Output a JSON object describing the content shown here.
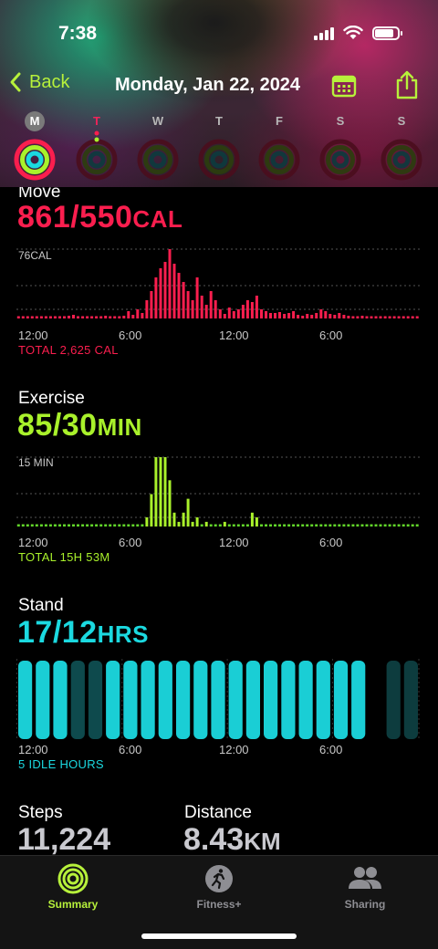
{
  "status_bar": {
    "time": "7:38",
    "battery_level": 0.85
  },
  "nav": {
    "back_label": "Back",
    "title": "Monday, Jan 22, 2024"
  },
  "week": [
    {
      "letter": "M",
      "state": "current"
    },
    {
      "letter": "T",
      "state": "today"
    },
    {
      "letter": "W",
      "state": "normal"
    },
    {
      "letter": "T",
      "state": "normal"
    },
    {
      "letter": "F",
      "state": "normal"
    },
    {
      "letter": "S",
      "state": "normal"
    },
    {
      "letter": "S",
      "state": "normal"
    }
  ],
  "move": {
    "title": "Move",
    "value": "861/550",
    "unit": "CAL",
    "max_label": "76CAL",
    "total": "TOTAL 2,625 CAL",
    "color": "#fa1e4e",
    "dim_color": "#d21a43"
  },
  "exercise": {
    "title": "Exercise",
    "value": "85/30",
    "unit": "MIN",
    "max_label": "15 MIN",
    "total": "TOTAL 15H 53M",
    "color": "#a9f12b",
    "dim_color": "#62d62a"
  },
  "stand": {
    "title": "Stand",
    "value": "17/12",
    "unit": "HRS",
    "total": "5 IDLE HOURS",
    "color": "#1bd9e0"
  },
  "axis_ticks": [
    "12:00",
    "6:00",
    "12:00",
    "6:00"
  ],
  "steps": {
    "label": "Steps",
    "value": "11,224"
  },
  "distance": {
    "label": "Distance",
    "value": "8.43",
    "unit": "KM"
  },
  "tabs": [
    {
      "label": "Summary",
      "active": true,
      "icon": "activity-rings-icon"
    },
    {
      "label": "Fitness+",
      "active": false,
      "icon": "running-figure-icon"
    },
    {
      "label": "Sharing",
      "active": false,
      "icon": "people-icon"
    }
  ],
  "chart_data": [
    {
      "type": "bar",
      "name": "Move",
      "ylabel": "76CAL",
      "x_ticks": [
        "12:00",
        "6:00",
        "12:00",
        "6:00"
      ],
      "values": [
        2,
        2,
        2,
        2,
        2,
        2,
        2,
        2,
        2,
        2,
        2,
        3,
        4,
        2,
        2,
        2,
        2,
        2,
        2,
        3,
        2,
        2,
        2,
        3,
        8,
        4,
        10,
        6,
        20,
        30,
        45,
        55,
        62,
        76,
        60,
        50,
        40,
        30,
        20,
        45,
        25,
        15,
        30,
        20,
        10,
        5,
        12,
        8,
        10,
        15,
        20,
        18,
        25,
        10,
        8,
        6,
        6,
        7,
        5,
        6,
        8,
        4,
        3,
        5,
        4,
        6,
        10,
        8,
        5,
        4,
        6,
        4,
        3,
        2,
        2,
        3,
        2,
        2,
        2,
        2,
        2,
        2,
        2,
        2,
        2,
        2,
        2,
        2
      ],
      "total": "TOTAL 2,625 CAL"
    },
    {
      "type": "bar",
      "name": "Exercise",
      "ylabel": "15 MIN",
      "x_ticks": [
        "12:00",
        "6:00",
        "12:00",
        "6:00"
      ],
      "values": [
        0,
        0,
        0,
        0,
        0,
        0,
        0,
        0,
        0,
        0,
        0,
        0,
        0,
        0,
        0,
        0,
        0,
        0,
        0,
        0,
        0,
        0,
        0,
        0,
        0,
        0,
        0,
        0,
        2,
        7,
        15,
        15,
        15,
        10,
        3,
        1,
        3,
        6,
        1,
        2,
        0,
        1,
        0,
        0,
        0,
        1,
        0,
        0,
        0,
        0,
        0,
        3,
        2,
        0,
        0,
        0,
        0,
        0,
        0,
        0,
        0,
        0,
        0,
        0,
        0,
        0,
        0,
        0,
        0,
        0,
        0,
        0,
        0,
        0,
        0,
        0,
        0,
        0,
        0,
        0,
        0,
        0,
        0,
        0,
        0,
        0,
        0,
        0
      ],
      "total": "TOTAL 15H 53M"
    },
    {
      "type": "bar",
      "name": "Stand",
      "x_ticks": [
        "12:00",
        "6:00",
        "12:00",
        "6:00"
      ],
      "values": [
        1,
        1,
        1,
        0,
        0,
        1,
        1,
        1,
        1,
        1,
        1,
        1,
        1,
        1,
        1,
        1,
        1,
        1,
        1,
        1,
        0,
        0,
        0
      ],
      "total": "5 IDLE HOURS"
    }
  ]
}
